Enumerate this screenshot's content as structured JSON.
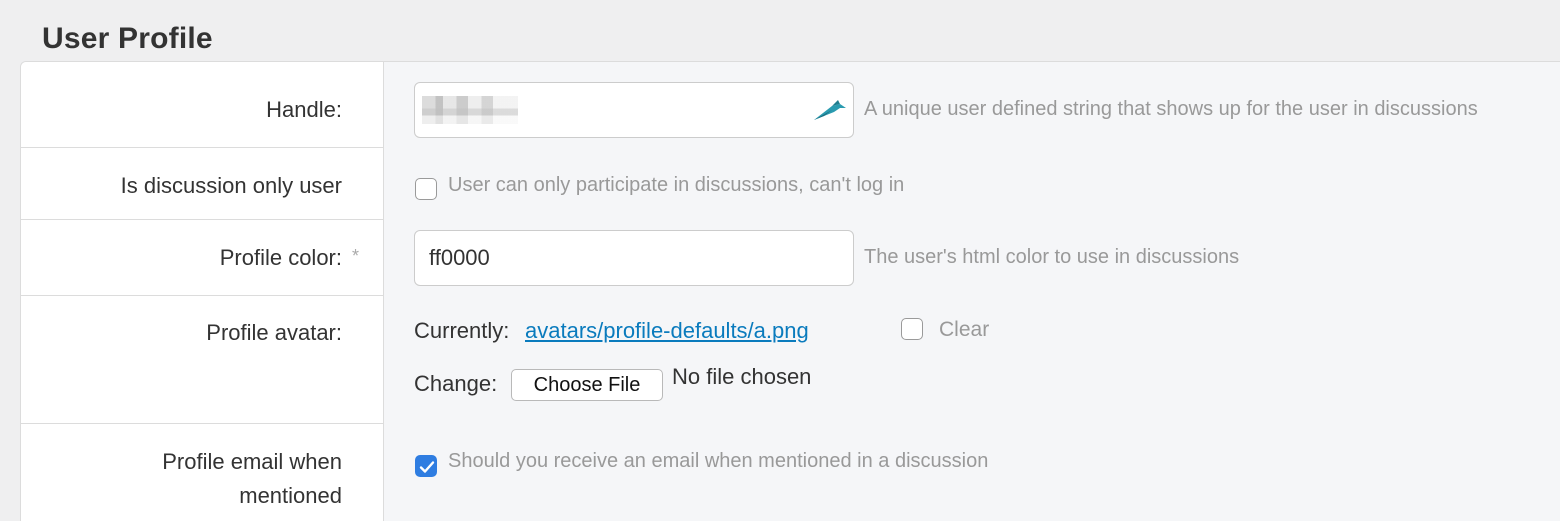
{
  "page": {
    "title": "User Profile"
  },
  "fields": {
    "handle": {
      "label": "Handle:",
      "value": "",
      "help": "A unique user defined string that shows up for the user in discussions",
      "icon": "pen-icon"
    },
    "discussion_only": {
      "label": "Is discussion only user",
      "checked": false,
      "help": "User can only participate in discussions, can't log in"
    },
    "profile_color": {
      "label": "Profile color:",
      "required_mark": "*",
      "value": "ff0000",
      "help": "The user's html color to use in discussions"
    },
    "profile_avatar": {
      "label": "Profile avatar:",
      "currently_label": "Currently:",
      "current_file": "avatars/profile-defaults/a.png",
      "clear_label": "Clear",
      "clear_checked": false,
      "change_label": "Change:",
      "choose_button": "Choose File",
      "no_file": "No file chosen"
    },
    "email_mentioned": {
      "label_line1": "Profile email when",
      "label_line2": "mentioned",
      "checked": true,
      "help": "Should you receive an email when mentioned in a discussion"
    }
  },
  "colors": {
    "accent": "#2f7de1",
    "link": "#0a7bbd",
    "muted": "#999999"
  }
}
